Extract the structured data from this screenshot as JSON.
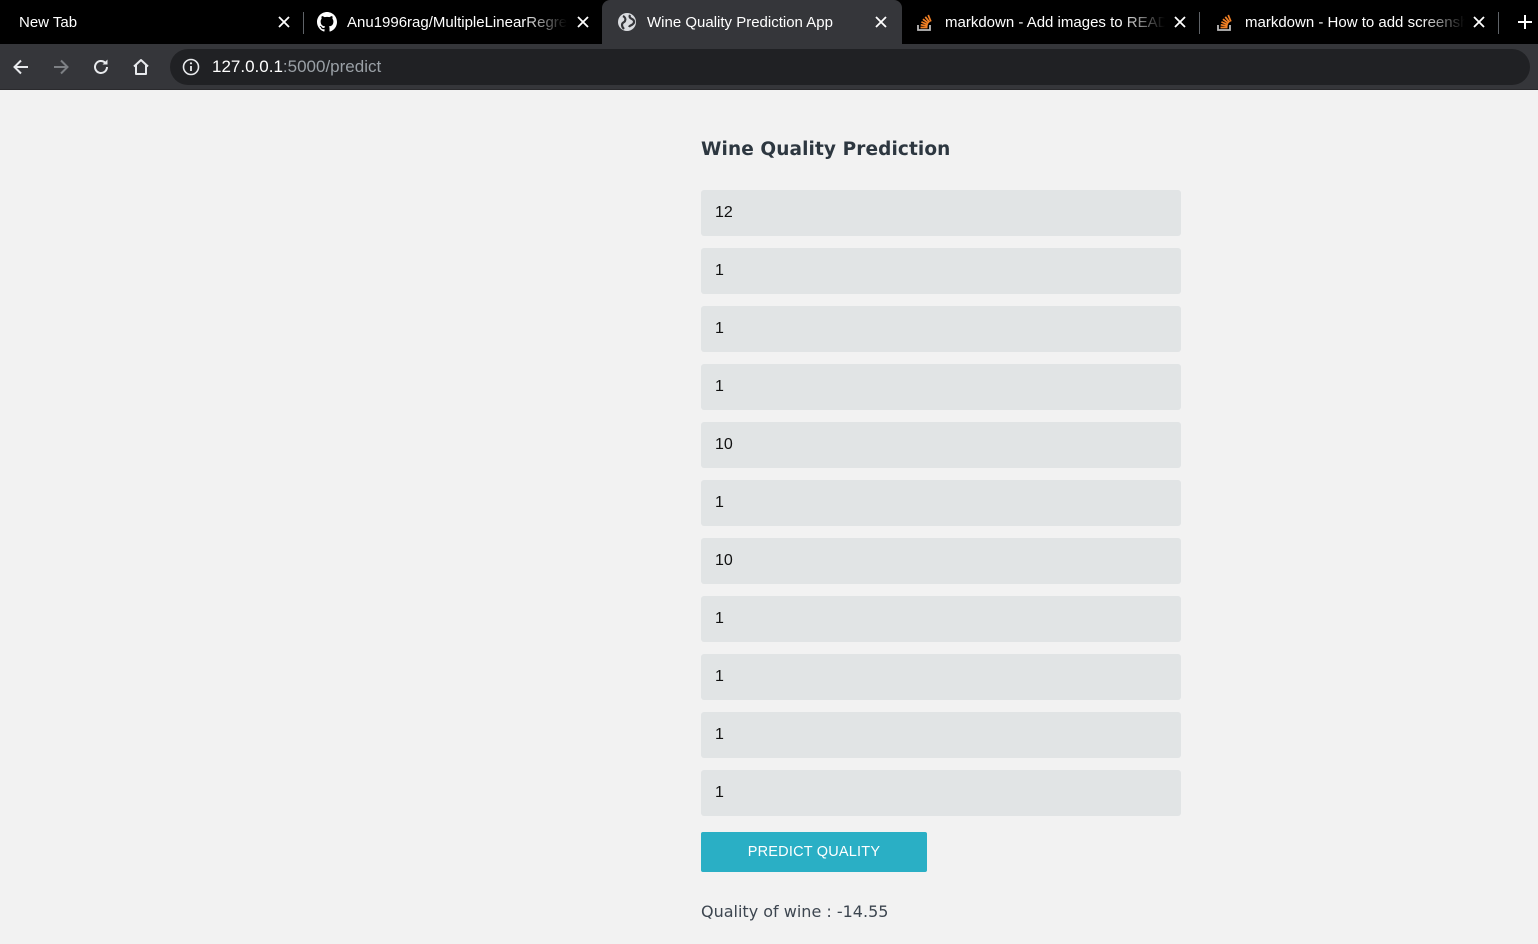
{
  "browser": {
    "tabs": [
      {
        "title": "New Tab",
        "icon": "none",
        "active": false
      },
      {
        "title": "Anu1996rag/MultipleLinearRegre",
        "icon": "github-icon",
        "active": false
      },
      {
        "title": "Wine Quality Prediction App",
        "icon": "globe-icon",
        "active": true
      },
      {
        "title": "markdown - Add images to READ",
        "icon": "stackoverflow-icon",
        "active": false
      },
      {
        "title": "markdown - How to add screensh",
        "icon": "stackoverflow-icon",
        "active": false
      }
    ],
    "new_tab_symbol": "+",
    "close_symbol": "×",
    "url_host": "127.0.0.1",
    "url_path": ":5000/predict"
  },
  "page": {
    "heading": "Wine Quality Prediction",
    "inputs": [
      {
        "value": "12"
      },
      {
        "value": "1"
      },
      {
        "value": "1"
      },
      {
        "value": "1"
      },
      {
        "value": "10"
      },
      {
        "value": "1"
      },
      {
        "value": "10"
      },
      {
        "value": "1"
      },
      {
        "value": "1"
      },
      {
        "value": "1"
      },
      {
        "value": "1"
      }
    ],
    "predict_button": "PREDICT QUALITY",
    "result": "Quality of wine : -14.55"
  },
  "colors": {
    "accent": "#2aafc5",
    "stackoverflow": "#f48024"
  }
}
